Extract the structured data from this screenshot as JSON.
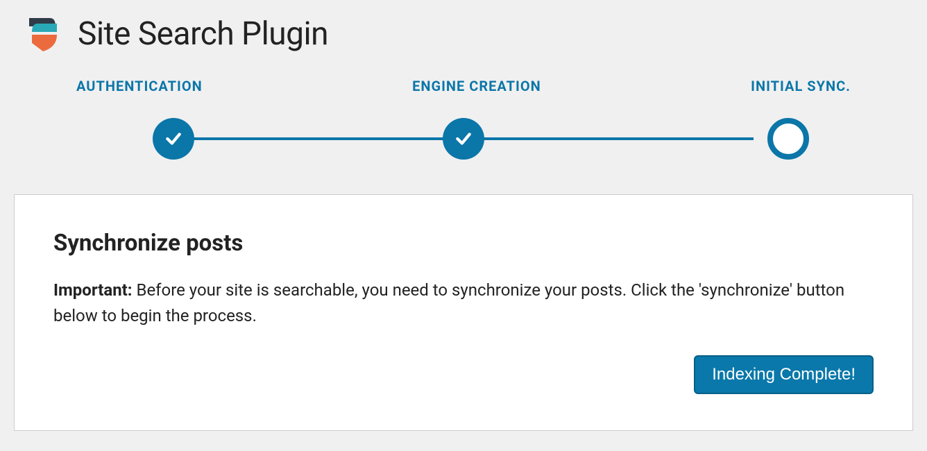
{
  "header": {
    "title": "Site Search Plugin"
  },
  "stepper": {
    "steps": [
      {
        "label": "AUTHENTICATION",
        "done": true
      },
      {
        "label": "ENGINE CREATION",
        "done": true
      },
      {
        "label": "INITIAL SYNC.",
        "done": false
      }
    ]
  },
  "card": {
    "heading": "Synchronize posts",
    "important_label": "Important:",
    "body": " Before your site is searchable, you need to synchronize your posts. Click the 'synchronize' button below to begin the process.",
    "button": "Indexing Complete!"
  },
  "colors": {
    "accent": "#0b76a8"
  }
}
